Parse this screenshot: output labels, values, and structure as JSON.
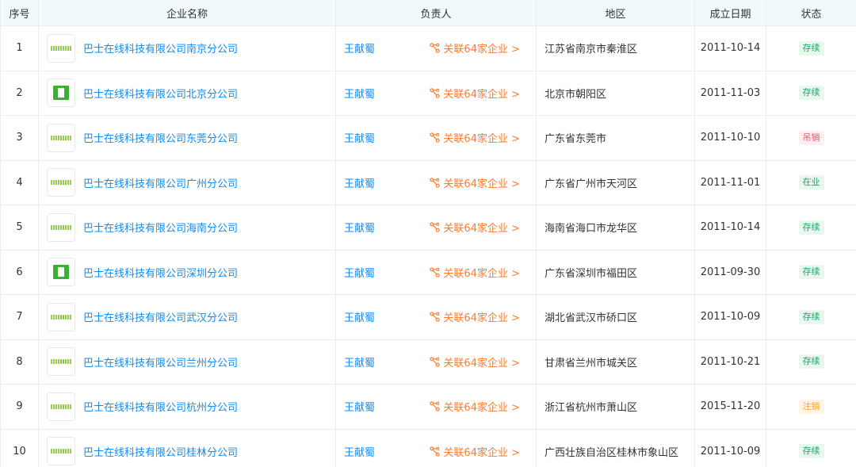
{
  "headers": {
    "index": "序号",
    "company": "企业名称",
    "person": "负责人",
    "region": "地区",
    "date": "成立日期",
    "status": "状态"
  },
  "colors": {
    "link": "#128bed",
    "assoc": "#ff7a2b",
    "header_bg": "#f2f9fc",
    "status_green": "#19a36b",
    "status_red": "#ff4d6a",
    "status_yellow": "#f5a623"
  },
  "rows": [
    {
      "index": "1",
      "logo": "stripe-logo",
      "company": "巴士在线科技有限公司南京分公司",
      "person": "王献蜀",
      "assoc": "关联64家企业 >",
      "region": "江苏省南京市秦淮区",
      "date": "2011-10-14",
      "status": "存续",
      "status_color": "green"
    },
    {
      "index": "2",
      "logo": "book-logo",
      "company": "巴士在线科技有限公司北京分公司",
      "person": "王献蜀",
      "assoc": "关联64家企业 >",
      "region": "北京市朝阳区",
      "date": "2011-11-03",
      "status": "存续",
      "status_color": "green"
    },
    {
      "index": "3",
      "logo": "stripe-logo",
      "company": "巴士在线科技有限公司东莞分公司",
      "person": "王献蜀",
      "assoc": "关联64家企业 >",
      "region": "广东省东莞市",
      "date": "2011-10-10",
      "status": "吊销",
      "status_color": "red"
    },
    {
      "index": "4",
      "logo": "stripe-logo",
      "company": "巴士在线科技有限公司广州分公司",
      "person": "王献蜀",
      "assoc": "关联64家企业 >",
      "region": "广东省广州市天河区",
      "date": "2011-11-01",
      "status": "在业",
      "status_color": "green"
    },
    {
      "index": "5",
      "logo": "stripe-logo",
      "company": "巴士在线科技有限公司海南分公司",
      "person": "王献蜀",
      "assoc": "关联64家企业 >",
      "region": "海南省海口市龙华区",
      "date": "2011-10-14",
      "status": "存续",
      "status_color": "green"
    },
    {
      "index": "6",
      "logo": "book-logo",
      "company": "巴士在线科技有限公司深圳分公司",
      "person": "王献蜀",
      "assoc": "关联64家企业 >",
      "region": "广东省深圳市福田区",
      "date": "2011-09-30",
      "status": "存续",
      "status_color": "green"
    },
    {
      "index": "7",
      "logo": "stripe-logo",
      "company": "巴士在线科技有限公司武汉分公司",
      "person": "王献蜀",
      "assoc": "关联64家企业 >",
      "region": "湖北省武汉市硚口区",
      "date": "2011-10-09",
      "status": "存续",
      "status_color": "green"
    },
    {
      "index": "8",
      "logo": "stripe-logo",
      "company": "巴士在线科技有限公司兰州分公司",
      "person": "王献蜀",
      "assoc": "关联64家企业 >",
      "region": "甘肃省兰州市城关区",
      "date": "2011-10-21",
      "status": "存续",
      "status_color": "green"
    },
    {
      "index": "9",
      "logo": "stripe-logo",
      "company": "巴士在线科技有限公司杭州分公司",
      "person": "王献蜀",
      "assoc": "关联64家企业 >",
      "region": "浙江省杭州市萧山区",
      "date": "2015-11-20",
      "status": "注销",
      "status_color": "yellow"
    },
    {
      "index": "10",
      "logo": "stripe-logo",
      "company": "巴士在线科技有限公司桂林分公司",
      "person": "王献蜀",
      "assoc": "关联64家企业 >",
      "region": "广西壮族自治区桂林市象山区",
      "date": "2011-10-09",
      "status": "存续",
      "status_color": "green"
    }
  ]
}
